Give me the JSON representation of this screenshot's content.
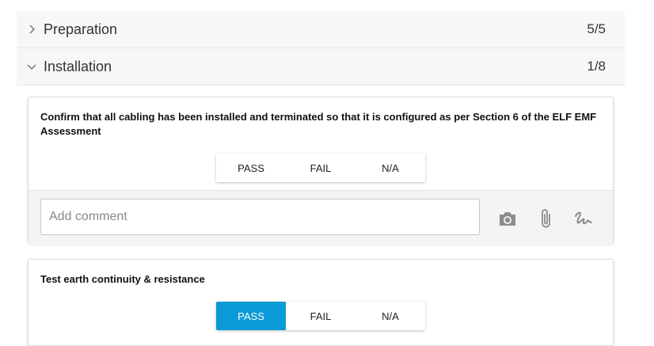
{
  "sections": [
    {
      "title": "Preparation",
      "progress": "5/5",
      "expanded": false
    },
    {
      "title": "Installation",
      "progress": "1/8",
      "expanded": true
    }
  ],
  "items": [
    {
      "question": "Confirm that all cabling has been installed and terminated so that it is configured as per Section 6 of the ELF EMF Assessment",
      "options": [
        "PASS",
        "FAIL",
        "N/A"
      ],
      "selected": null,
      "comment_placeholder": "Add comment",
      "tools": [
        "camera-icon",
        "paperclip-icon",
        "signature-icon"
      ]
    },
    {
      "question": "Test earth continuity & resistance",
      "options": [
        "PASS",
        "FAIL",
        "N/A"
      ],
      "selected": "PASS"
    }
  ],
  "colors": {
    "accent": "#0a9ad7",
    "section_bg": "#f7f7f8",
    "icon_gray": "#8c8c8c"
  }
}
